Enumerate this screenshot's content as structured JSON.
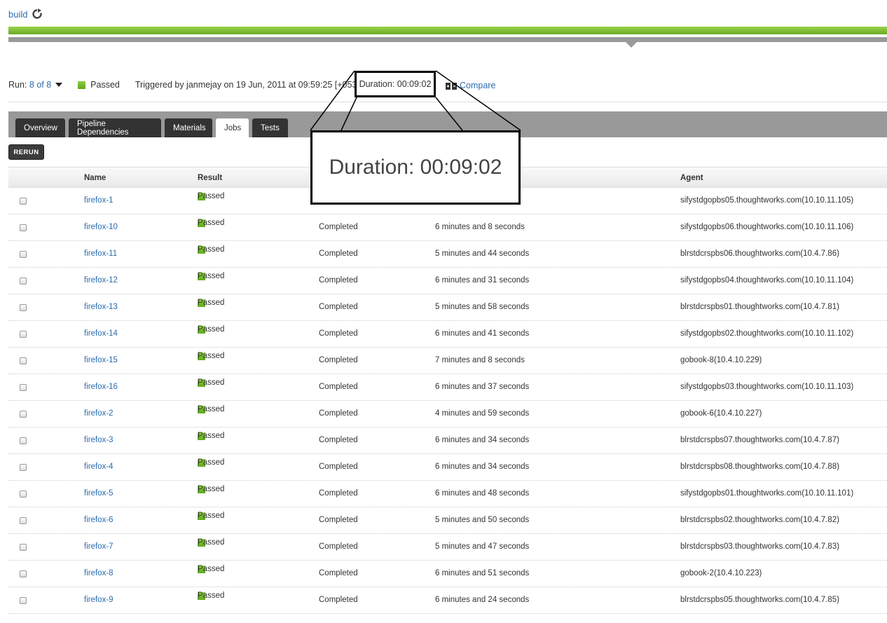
{
  "breadcrumb": {
    "label": "build"
  },
  "run": {
    "label": "Run:",
    "value": "8 of 8",
    "status": "Passed",
    "triggered": "Triggered by janmejay on 19 Jun, 2011 at 09:59:25 [+0530]",
    "duration": "Duration: 00:09:02",
    "compare": "Compare"
  },
  "tabs": [
    "Overview",
    "Pipeline Dependencies",
    "Materials",
    "Jobs",
    "Tests"
  ],
  "rerun_label": "RERUN",
  "table": {
    "headers": {
      "name": "Name",
      "result": "Result",
      "agent": "Agent"
    },
    "rows": [
      {
        "name": "firefox-1",
        "result": "Passed",
        "state": "",
        "duration": "",
        "agent": "sifystdgopbs05.thoughtworks.com(10.10.11.105)"
      },
      {
        "name": "firefox-10",
        "result": "Passed",
        "state": "Completed",
        "duration": "6 minutes and 8 seconds",
        "agent": "sifystdgopbs06.thoughtworks.com(10.10.11.106)"
      },
      {
        "name": "firefox-11",
        "result": "Passed",
        "state": "Completed",
        "duration": "5 minutes and 44 seconds",
        "agent": "blrstdcrspbs06.thoughtworks.com(10.4.7.86)"
      },
      {
        "name": "firefox-12",
        "result": "Passed",
        "state": "Completed",
        "duration": "6 minutes and 31 seconds",
        "agent": "sifystdgopbs04.thoughtworks.com(10.10.11.104)"
      },
      {
        "name": "firefox-13",
        "result": "Passed",
        "state": "Completed",
        "duration": "5 minutes and 58 seconds",
        "agent": "blrstdcrspbs01.thoughtworks.com(10.4.7.81)"
      },
      {
        "name": "firefox-14",
        "result": "Passed",
        "state": "Completed",
        "duration": "6 minutes and 41 seconds",
        "agent": "sifystdgopbs02.thoughtworks.com(10.10.11.102)"
      },
      {
        "name": "firefox-15",
        "result": "Passed",
        "state": "Completed",
        "duration": "7 minutes and 8 seconds",
        "agent": "gobook-8(10.4.10.229)"
      },
      {
        "name": "firefox-16",
        "result": "Passed",
        "state": "Completed",
        "duration": "6 minutes and 37 seconds",
        "agent": "sifystdgopbs03.thoughtworks.com(10.10.11.103)"
      },
      {
        "name": "firefox-2",
        "result": "Passed",
        "state": "Completed",
        "duration": "4 minutes and 59 seconds",
        "agent": "gobook-6(10.4.10.227)"
      },
      {
        "name": "firefox-3",
        "result": "Passed",
        "state": "Completed",
        "duration": "6 minutes and 34 seconds",
        "agent": "blrstdcrspbs07.thoughtworks.com(10.4.7.87)"
      },
      {
        "name": "firefox-4",
        "result": "Passed",
        "state": "Completed",
        "duration": "6 minutes and 34 seconds",
        "agent": "blrstdcrspbs08.thoughtworks.com(10.4.7.88)"
      },
      {
        "name": "firefox-5",
        "result": "Passed",
        "state": "Completed",
        "duration": "6 minutes and 48 seconds",
        "agent": "sifystdgopbs01.thoughtworks.com(10.10.11.101)"
      },
      {
        "name": "firefox-6",
        "result": "Passed",
        "state": "Completed",
        "duration": "5 minutes and 50 seconds",
        "agent": "blrstdcrspbs02.thoughtworks.com(10.4.7.82)"
      },
      {
        "name": "firefox-7",
        "result": "Passed",
        "state": "Completed",
        "duration": "5 minutes and 47 seconds",
        "agent": "blrstdcrspbs03.thoughtworks.com(10.4.7.83)"
      },
      {
        "name": "firefox-8",
        "result": "Passed",
        "state": "Completed",
        "duration": "6 minutes and 51 seconds",
        "agent": "gobook-2(10.4.10.223)"
      },
      {
        "name": "firefox-9",
        "result": "Passed",
        "state": "Completed",
        "duration": "6 minutes and 24 seconds",
        "agent": "blrstdcrspbs05.thoughtworks.com(10.4.7.85)"
      }
    ]
  },
  "zoom_callout": {
    "text": "Duration: 00:09:02"
  },
  "icons": {
    "refresh": "refresh-icon",
    "dropdown": "caret-down-icon",
    "status": "passed-square-icon",
    "compare": "compare-icon"
  },
  "colors": {
    "accent": "#6aab23",
    "link": "#2b6cb0",
    "tab_dark": "#333333",
    "tabbar": "#999999"
  }
}
